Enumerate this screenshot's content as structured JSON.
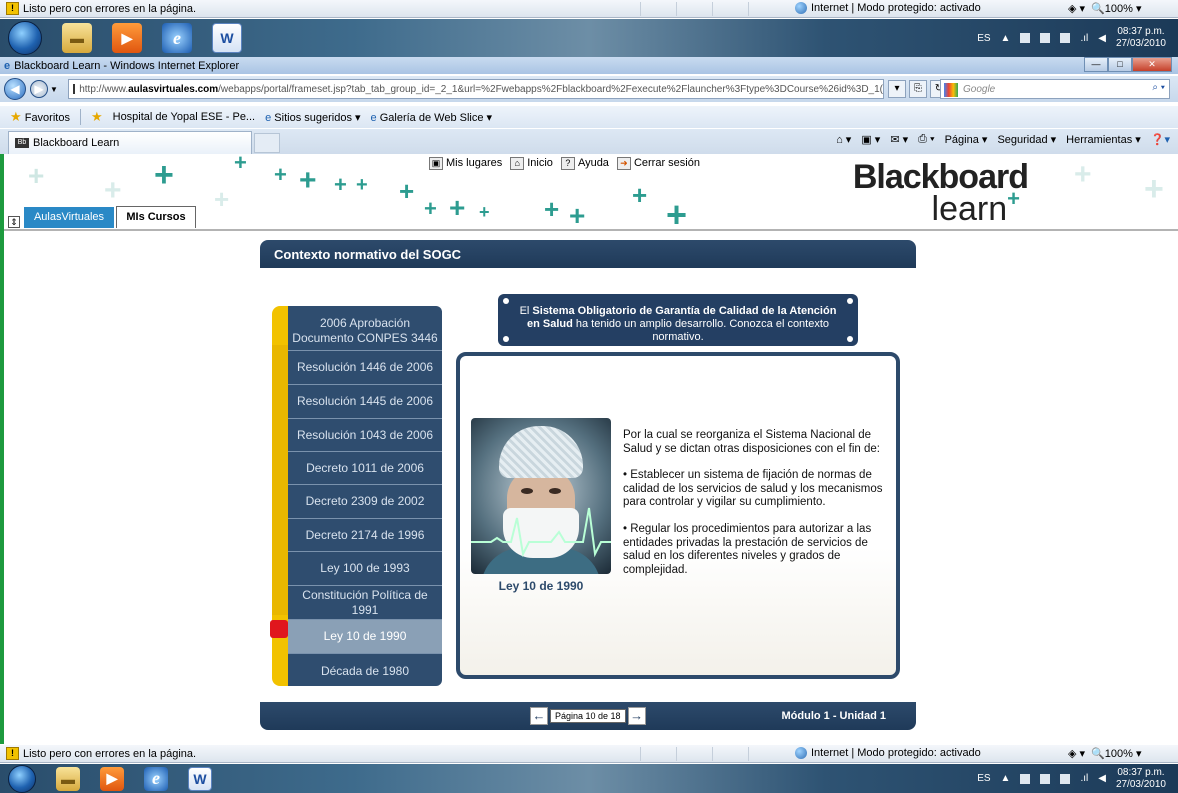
{
  "status": {
    "text": "Listo pero con errores en la página.",
    "zone": "Internet | Modo protegido: activado",
    "zoom": "100%"
  },
  "taskbar": {
    "lang": "ES",
    "time": "08:37 p.m.",
    "date": "27/03/2010"
  },
  "window": {
    "title": "Blackboard Learn - Windows Internet Explorer"
  },
  "address": {
    "prefix": "http://www.",
    "domain": "aulasvirtuales.com",
    "path": "/webapps/portal/frameset.jsp?tab_tab_group_id=_2_1&url=%2Fwebapps%2Fblackboard%2Fexecute%2Flauncher%3Ftype%3DCourse%26id%3D_1(",
    "search_placeholder": "Google"
  },
  "favorites": {
    "label": "Favoritos",
    "items": [
      "Hospital de Yopal ESE - Pe...",
      "Sitios sugeridos ▾",
      "Galería de Web Slice ▾"
    ]
  },
  "tab": {
    "label": "Blackboard Learn"
  },
  "commands": {
    "page": "Página ▾",
    "security": "Seguridad ▾",
    "tools": "Herramientas ▾"
  },
  "bb": {
    "links": [
      "Mis lugares",
      "Inicio",
      "Ayuda",
      "Cerrar sesión"
    ],
    "logo_top": "Blackboard",
    "logo_bottom": "learn",
    "tab1": "AulasVirtuales",
    "tab2": "MIs Cursos"
  },
  "course": {
    "header": "Contexto normativo del SOGC",
    "info_bold1": "Sistema Obligatorio de Garantía de Calidad de la Atención en Salud",
    "info_pre": "El ",
    "info_post": " ha tenido un amplio desarrollo. Conozca el contexto normativo.",
    "nav": [
      "2006 Aprobación Documento CONPES 3446",
      "Resolución 1446 de 2006",
      "Resolución 1445 de 2006",
      "Resolución 1043 de 2006",
      "Decreto 1011 de 2006",
      "Decreto 2309 de 2002",
      "Decreto 2174 de 1996",
      "Ley 100 de 1993",
      "Constitución Política de 1991",
      "Ley 10 de 1990",
      "Década de 1980"
    ],
    "active_index": 9,
    "photo_caption": "Ley 10 de 1990",
    "text_intro": "Por la cual se reorganiza el Sistema Nacional de Salud y se dictan otras disposiciones con el fin de:",
    "text_b1": "• Establecer un sistema de fijación de normas de calidad de los servicios de salud y los mecanismos para controlar y vigilar su cumplimiento.",
    "text_b2": "• Regular los procedimientos para autorizar a las entidades privadas la prestación de servicios de salud en los diferentes niveles y grados de complejidad.",
    "page": "Página 10 de 18",
    "module": "Módulo 1 - Unidad 1"
  }
}
